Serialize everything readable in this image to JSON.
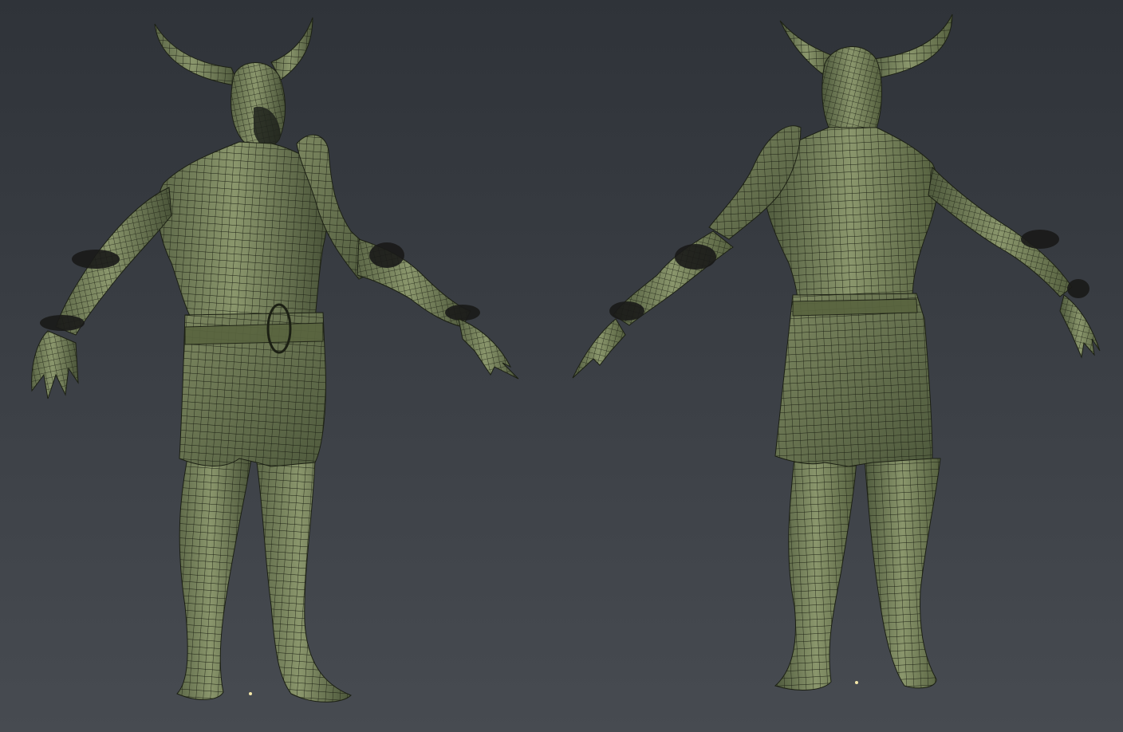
{
  "viewport": {
    "background_top": "#2f3339",
    "background_bottom": "#474b51"
  },
  "model": {
    "surface_color": "#6e7a55",
    "surface_highlight": "#8c9870",
    "surface_shadow": "#3e4630",
    "wire_color": "#1c2014",
    "fur_color": "#1a1a18"
  },
  "views": [
    {
      "id": "front",
      "icon": "character-front-view"
    },
    {
      "id": "back",
      "icon": "character-back-view"
    }
  ],
  "markers": [
    {
      "id": "front-origin",
      "color": "#f4e7a8"
    },
    {
      "id": "back-origin",
      "color": "#f4e7a8"
    }
  ]
}
